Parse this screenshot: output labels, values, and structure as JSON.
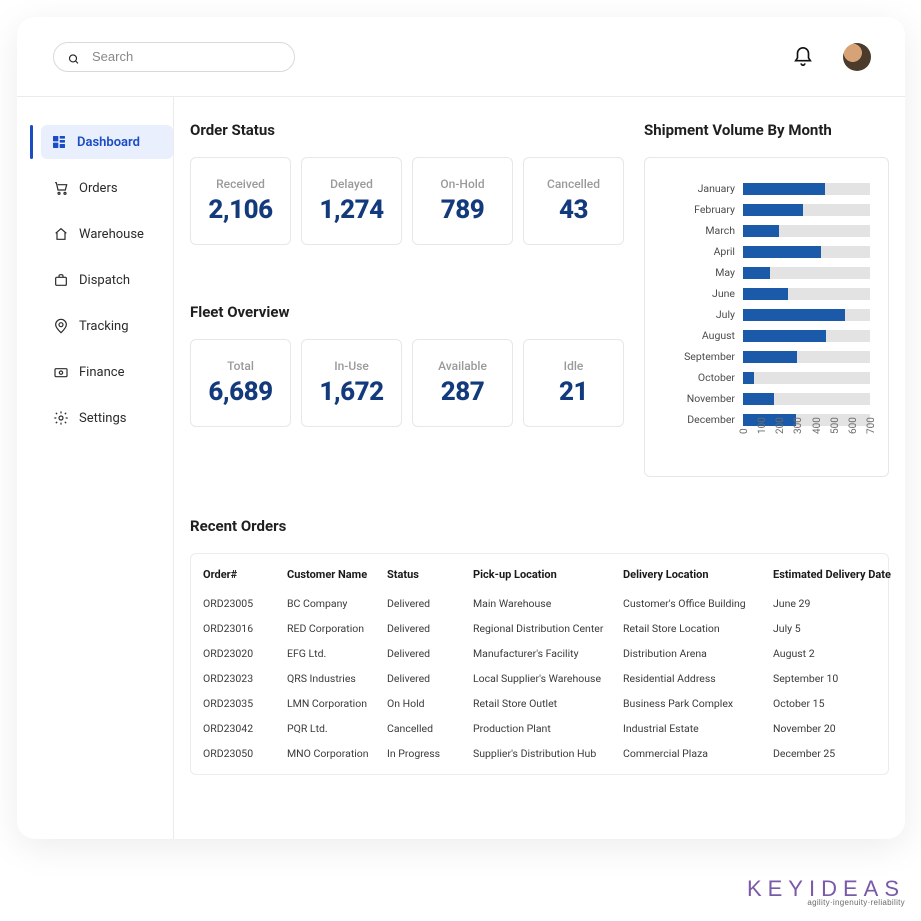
{
  "search": {
    "placeholder": "Search"
  },
  "sidebar": {
    "items": [
      {
        "label": "Dashboard",
        "icon": "grid-icon",
        "active": true
      },
      {
        "label": "Orders",
        "icon": "cart-icon"
      },
      {
        "label": "Warehouse",
        "icon": "home-icon"
      },
      {
        "label": "Dispatch",
        "icon": "briefcase-icon"
      },
      {
        "label": "Tracking",
        "icon": "pin-icon"
      },
      {
        "label": "Finance",
        "icon": "money-icon"
      },
      {
        "label": "Settings",
        "icon": "gear-icon"
      }
    ]
  },
  "order_status": {
    "title": "Order Status",
    "cards": [
      {
        "label": "Received",
        "value": "2,106"
      },
      {
        "label": "Delayed",
        "value": "1,274"
      },
      {
        "label": "On-Hold",
        "value": "789"
      },
      {
        "label": "Cancelled",
        "value": "43"
      }
    ]
  },
  "fleet": {
    "title": "Fleet Overview",
    "cards": [
      {
        "label": "Total",
        "value": "6,689"
      },
      {
        "label": "In-Use",
        "value": "1,672"
      },
      {
        "label": "Available",
        "value": "287"
      },
      {
        "label": "Idle",
        "value": "21"
      }
    ]
  },
  "chart_title": "Shipment Volume By Month",
  "chart_data": {
    "type": "bar",
    "orientation": "horizontal",
    "title": "Shipment Volume By Month",
    "xlabel": "",
    "ylabel": "",
    "xlim": [
      0,
      700
    ],
    "ticks": [
      0,
      100,
      200,
      300,
      400,
      500,
      600,
      700
    ],
    "categories": [
      "January",
      "February",
      "March",
      "April",
      "May",
      "June",
      "July",
      "August",
      "September",
      "October",
      "November",
      "December"
    ],
    "values": [
      450,
      330,
      200,
      430,
      150,
      250,
      560,
      460,
      300,
      60,
      170,
      290
    ]
  },
  "recent": {
    "title": "Recent Orders",
    "columns": [
      "Order#",
      "Customer Name",
      "Status",
      "Pick-up Location",
      "Delivery Location",
      "Estimated Delivery Date"
    ],
    "rows": [
      [
        "ORD23005",
        "BC Company",
        "Delivered",
        "Main Warehouse",
        "Customer's Office Building",
        "June 29"
      ],
      [
        "ORD23016",
        "RED Corporation",
        "Delivered",
        "Regional Distribution Center",
        "Retail Store Location",
        "July 5"
      ],
      [
        "ORD23020",
        "EFG Ltd.",
        "Delivered",
        "Manufacturer's Facility",
        "Distribution Arena",
        "August 2"
      ],
      [
        "ORD23023",
        "QRS Industries",
        "Delivered",
        "Local Supplier's Warehouse",
        "Residential Address",
        "September 10"
      ],
      [
        "ORD23035",
        "LMN Corporation",
        "On Hold",
        "Retail Store Outlet",
        "Business Park Complex",
        "October 15"
      ],
      [
        "ORD23042",
        "PQR Ltd.",
        "Cancelled",
        "Production Plant",
        "Industrial Estate",
        "November 20"
      ],
      [
        "ORD23050",
        "MNO Corporation",
        "In Progress",
        "Supplier's Distribution Hub",
        "Commercial Plaza",
        "December 25"
      ]
    ]
  },
  "brand": {
    "name": "KEYIDEAS",
    "tag": "agility·ingenuity·reliability"
  }
}
